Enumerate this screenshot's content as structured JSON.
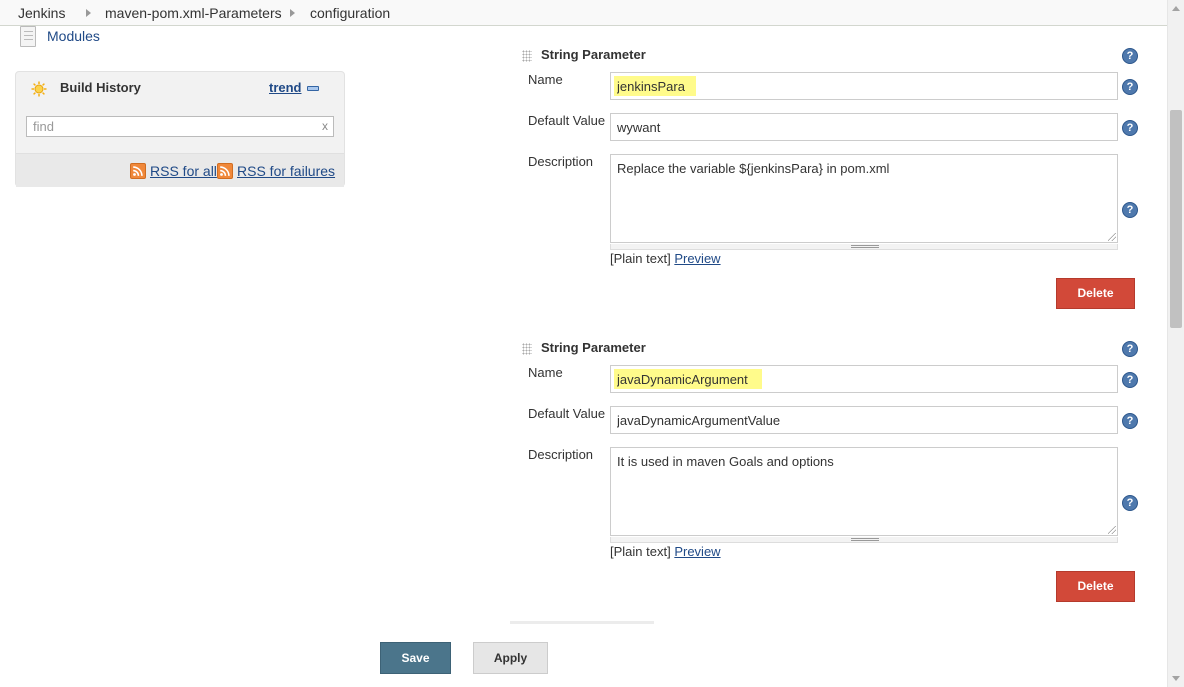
{
  "breadcrumb": {
    "items": [
      "Jenkins",
      "maven-pom.xml-Parameters",
      "configuration"
    ]
  },
  "sidebar": {
    "modules_label": "Modules",
    "build_history": {
      "title": "Build History",
      "trend_label": "trend",
      "search_placeholder": "find",
      "clear_label": "x",
      "rss_all_label": "RSS for all",
      "rss_failures_label": "RSS for failures"
    }
  },
  "parameters": [
    {
      "title": "String Parameter",
      "name_label": "Name",
      "name_value": "jenkinsPara",
      "default_label": "Default Value",
      "default_value": "wywant",
      "description_label": "Description",
      "description_value": "Replace the variable ${jenkinsPara} in pom.xml",
      "plain_text": "[Plain text]",
      "preview_label": "Preview",
      "delete_label": "Delete"
    },
    {
      "title": "String Parameter",
      "name_label": "Name",
      "name_value": "javaDynamicArgument",
      "default_label": "Default Value",
      "default_value": "javaDynamicArgumentValue",
      "description_label": "Description",
      "description_value": "It is used in maven Goals and options",
      "plain_text": "[Plain text]",
      "preview_label": "Preview",
      "delete_label": "Delete"
    }
  ],
  "help_glyph": "?",
  "actions": {
    "save_label": "Save",
    "apply_label": "Apply"
  },
  "colors": {
    "delete": "#d24939",
    "save": "#4b758b",
    "highlight": "#fffb8b",
    "link": "#204a87"
  }
}
